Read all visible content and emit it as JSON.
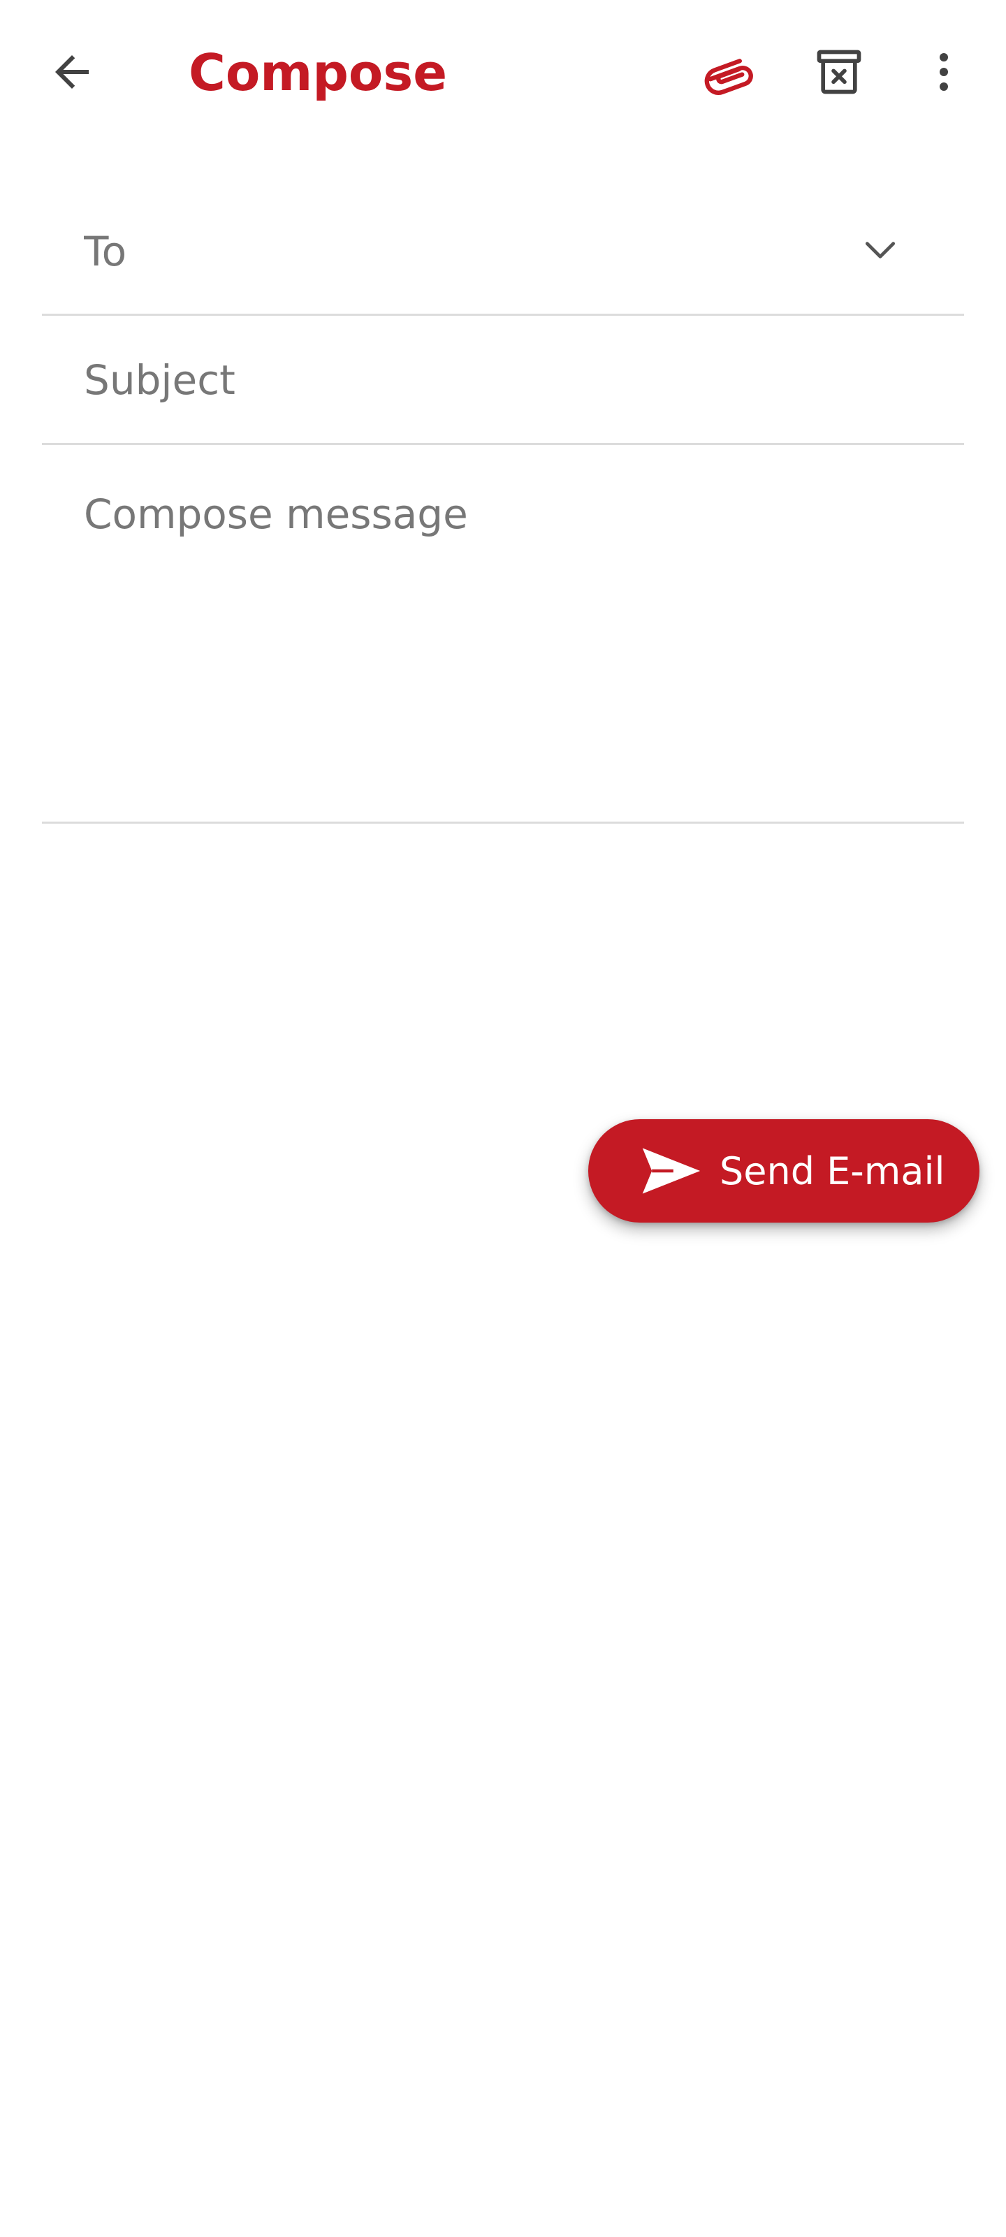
{
  "header": {
    "title": "Compose",
    "back_icon": "arrow-back-icon",
    "attach_icon": "paperclip-icon",
    "discard_icon": "delete-draft-icon",
    "more_icon": "more-vertical-icon"
  },
  "form": {
    "to": {
      "value": "",
      "placeholder": "To"
    },
    "subject": {
      "value": "",
      "placeholder": "Subject"
    },
    "body": {
      "value": "",
      "placeholder": "Compose message"
    }
  },
  "fab": {
    "label": "Send E-mail",
    "icon": "send-icon"
  },
  "colors": {
    "accent": "#c41a24",
    "icon_dark": "#424242",
    "placeholder": "#777777",
    "divider": "#dcdcdc"
  }
}
